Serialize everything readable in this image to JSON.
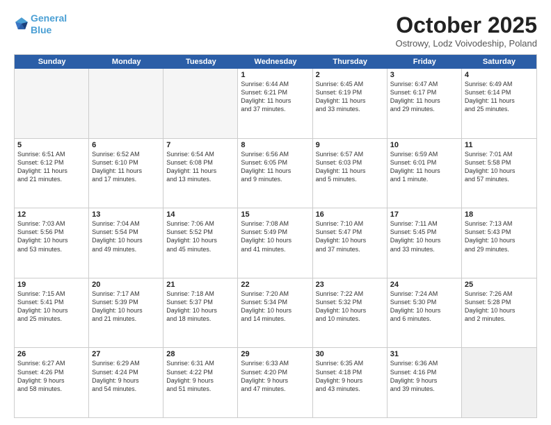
{
  "header": {
    "logo_line1": "General",
    "logo_line2": "Blue",
    "month": "October 2025",
    "location": "Ostrowy, Lodz Voivodeship, Poland"
  },
  "weekdays": [
    "Sunday",
    "Monday",
    "Tuesday",
    "Wednesday",
    "Thursday",
    "Friday",
    "Saturday"
  ],
  "rows": [
    [
      {
        "day": "",
        "info": "",
        "empty": true
      },
      {
        "day": "",
        "info": "",
        "empty": true
      },
      {
        "day": "",
        "info": "",
        "empty": true
      },
      {
        "day": "1",
        "info": "Sunrise: 6:44 AM\nSunset: 6:21 PM\nDaylight: 11 hours\nand 37 minutes."
      },
      {
        "day": "2",
        "info": "Sunrise: 6:45 AM\nSunset: 6:19 PM\nDaylight: 11 hours\nand 33 minutes."
      },
      {
        "day": "3",
        "info": "Sunrise: 6:47 AM\nSunset: 6:17 PM\nDaylight: 11 hours\nand 29 minutes."
      },
      {
        "day": "4",
        "info": "Sunrise: 6:49 AM\nSunset: 6:14 PM\nDaylight: 11 hours\nand 25 minutes."
      }
    ],
    [
      {
        "day": "5",
        "info": "Sunrise: 6:51 AM\nSunset: 6:12 PM\nDaylight: 11 hours\nand 21 minutes."
      },
      {
        "day": "6",
        "info": "Sunrise: 6:52 AM\nSunset: 6:10 PM\nDaylight: 11 hours\nand 17 minutes."
      },
      {
        "day": "7",
        "info": "Sunrise: 6:54 AM\nSunset: 6:08 PM\nDaylight: 11 hours\nand 13 minutes."
      },
      {
        "day": "8",
        "info": "Sunrise: 6:56 AM\nSunset: 6:05 PM\nDaylight: 11 hours\nand 9 minutes."
      },
      {
        "day": "9",
        "info": "Sunrise: 6:57 AM\nSunset: 6:03 PM\nDaylight: 11 hours\nand 5 minutes."
      },
      {
        "day": "10",
        "info": "Sunrise: 6:59 AM\nSunset: 6:01 PM\nDaylight: 11 hours\nand 1 minute."
      },
      {
        "day": "11",
        "info": "Sunrise: 7:01 AM\nSunset: 5:58 PM\nDaylight: 10 hours\nand 57 minutes."
      }
    ],
    [
      {
        "day": "12",
        "info": "Sunrise: 7:03 AM\nSunset: 5:56 PM\nDaylight: 10 hours\nand 53 minutes."
      },
      {
        "day": "13",
        "info": "Sunrise: 7:04 AM\nSunset: 5:54 PM\nDaylight: 10 hours\nand 49 minutes."
      },
      {
        "day": "14",
        "info": "Sunrise: 7:06 AM\nSunset: 5:52 PM\nDaylight: 10 hours\nand 45 minutes."
      },
      {
        "day": "15",
        "info": "Sunrise: 7:08 AM\nSunset: 5:49 PM\nDaylight: 10 hours\nand 41 minutes."
      },
      {
        "day": "16",
        "info": "Sunrise: 7:10 AM\nSunset: 5:47 PM\nDaylight: 10 hours\nand 37 minutes."
      },
      {
        "day": "17",
        "info": "Sunrise: 7:11 AM\nSunset: 5:45 PM\nDaylight: 10 hours\nand 33 minutes."
      },
      {
        "day": "18",
        "info": "Sunrise: 7:13 AM\nSunset: 5:43 PM\nDaylight: 10 hours\nand 29 minutes."
      }
    ],
    [
      {
        "day": "19",
        "info": "Sunrise: 7:15 AM\nSunset: 5:41 PM\nDaylight: 10 hours\nand 25 minutes."
      },
      {
        "day": "20",
        "info": "Sunrise: 7:17 AM\nSunset: 5:39 PM\nDaylight: 10 hours\nand 21 minutes."
      },
      {
        "day": "21",
        "info": "Sunrise: 7:18 AM\nSunset: 5:37 PM\nDaylight: 10 hours\nand 18 minutes."
      },
      {
        "day": "22",
        "info": "Sunrise: 7:20 AM\nSunset: 5:34 PM\nDaylight: 10 hours\nand 14 minutes."
      },
      {
        "day": "23",
        "info": "Sunrise: 7:22 AM\nSunset: 5:32 PM\nDaylight: 10 hours\nand 10 minutes."
      },
      {
        "day": "24",
        "info": "Sunrise: 7:24 AM\nSunset: 5:30 PM\nDaylight: 10 hours\nand 6 minutes."
      },
      {
        "day": "25",
        "info": "Sunrise: 7:26 AM\nSunset: 5:28 PM\nDaylight: 10 hours\nand 2 minutes."
      }
    ],
    [
      {
        "day": "26",
        "info": "Sunrise: 6:27 AM\nSunset: 4:26 PM\nDaylight: 9 hours\nand 58 minutes."
      },
      {
        "day": "27",
        "info": "Sunrise: 6:29 AM\nSunset: 4:24 PM\nDaylight: 9 hours\nand 54 minutes."
      },
      {
        "day": "28",
        "info": "Sunrise: 6:31 AM\nSunset: 4:22 PM\nDaylight: 9 hours\nand 51 minutes."
      },
      {
        "day": "29",
        "info": "Sunrise: 6:33 AM\nSunset: 4:20 PM\nDaylight: 9 hours\nand 47 minutes."
      },
      {
        "day": "30",
        "info": "Sunrise: 6:35 AM\nSunset: 4:18 PM\nDaylight: 9 hours\nand 43 minutes."
      },
      {
        "day": "31",
        "info": "Sunrise: 6:36 AM\nSunset: 4:16 PM\nDaylight: 9 hours\nand 39 minutes."
      },
      {
        "day": "",
        "info": "",
        "empty": true,
        "shaded": true
      }
    ]
  ]
}
